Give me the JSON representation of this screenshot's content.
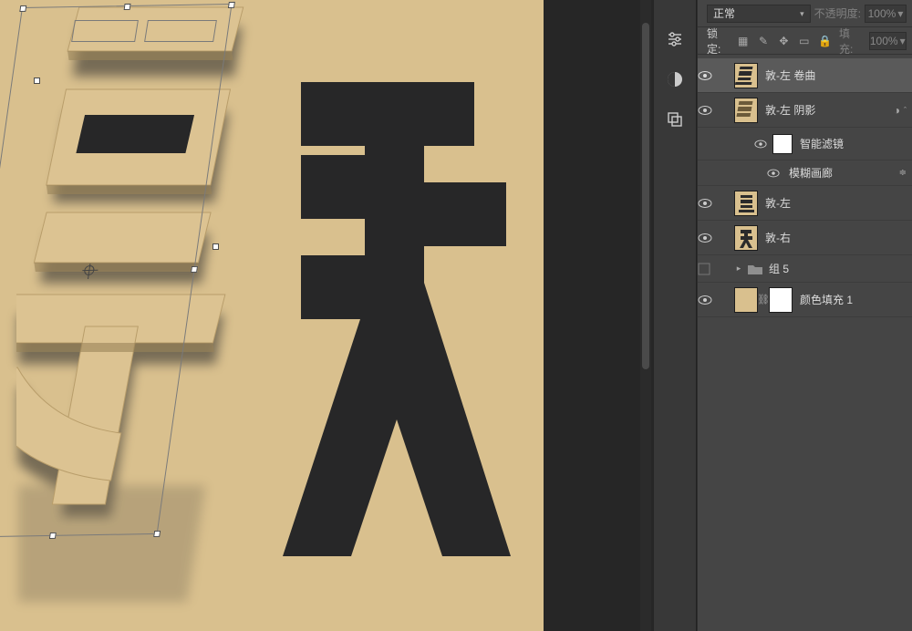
{
  "topbar": {
    "blend_mode": "正常",
    "opacity_label": "不透明度:",
    "opacity_value": "100%"
  },
  "lockbar": {
    "label": "锁定:",
    "fill_label": "填充:",
    "fill_value": "100%"
  },
  "layers": [
    {
      "id": "l1",
      "name": "敦-左 卷曲",
      "selected": true,
      "thumb": "beige-stripe"
    },
    {
      "id": "l2",
      "name": "敦-左 阴影",
      "selected": false,
      "thumb": "beige-stripe",
      "smart": true
    },
    {
      "id": "l2a",
      "name": "智能滤镜",
      "sub": true,
      "thumb": "white"
    },
    {
      "id": "l2b",
      "name": "模糊画廊",
      "subsub": true
    },
    {
      "id": "l3",
      "name": "敦-左",
      "thumb": "beige-ideo"
    },
    {
      "id": "l4",
      "name": "敦-右",
      "thumb": "beige-ideo"
    },
    {
      "id": "l5",
      "name": "组 5",
      "group": true
    },
    {
      "id": "l6",
      "name": "颜色填充 1",
      "fillpair": true
    }
  ],
  "canvas": {
    "bg": "#d9c08e",
    "glyph_color": "#272728"
  }
}
